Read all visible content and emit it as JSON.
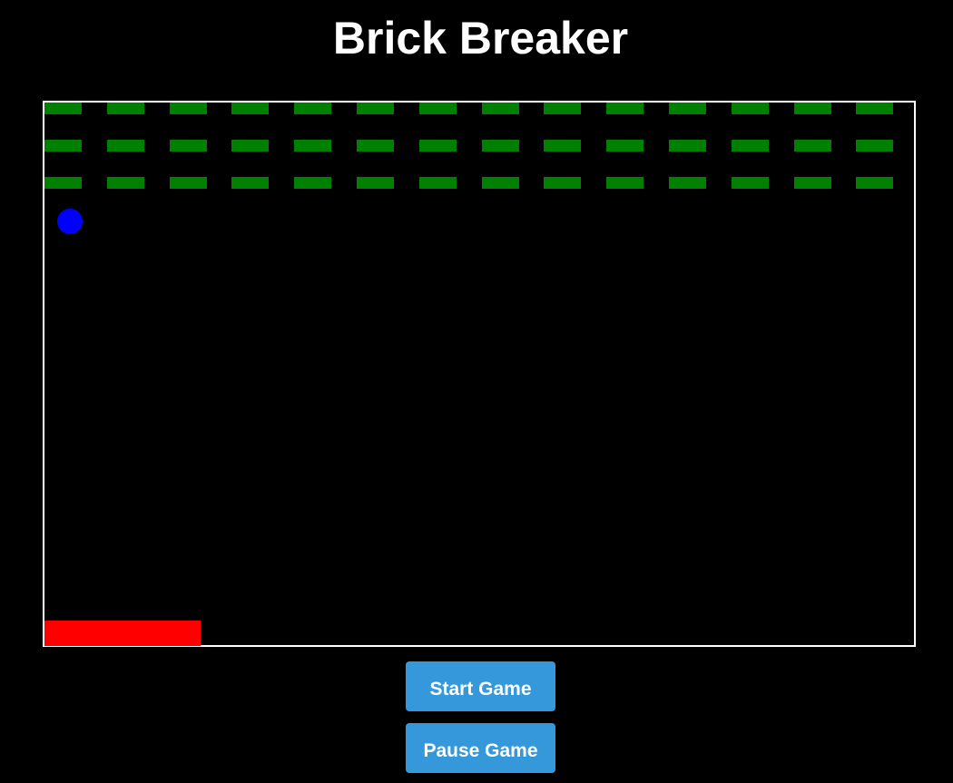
{
  "title": "Brick Breaker",
  "colors": {
    "background": "#000000",
    "board_border": "#ffffff",
    "brick": "#008000",
    "ball": "#0000ff",
    "paddle": "#ff0000",
    "button": "#3498db",
    "text": "#ffffff"
  },
  "bricks": {
    "rows": 3,
    "columns": 14
  },
  "buttons": {
    "start_label": "Start Game",
    "pause_label": "Pause Game"
  }
}
